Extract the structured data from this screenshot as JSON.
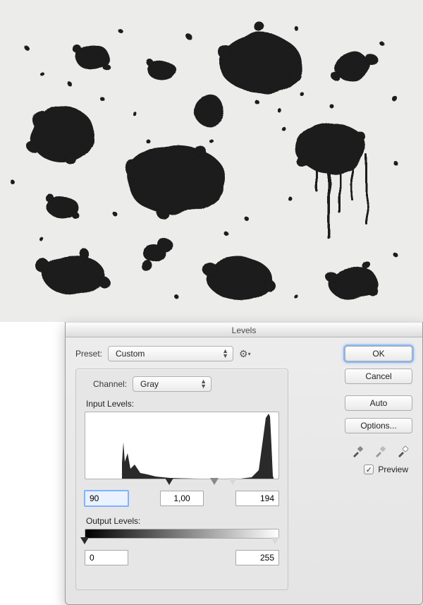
{
  "dialog": {
    "title": "Levels",
    "preset_label": "Preset:",
    "preset_value": "Custom",
    "channel_label": "Channel:",
    "channel_value": "Gray",
    "input_levels_label": "Input Levels:",
    "output_levels_label": "Output Levels:",
    "input_black": "90",
    "input_gamma": "1,00",
    "input_white": "194",
    "output_black": "0",
    "output_white": "255",
    "buttons": {
      "ok": "OK",
      "cancel": "Cancel",
      "auto": "Auto",
      "options": "Options..."
    },
    "preview_label": "Preview",
    "preview_checked": true
  }
}
